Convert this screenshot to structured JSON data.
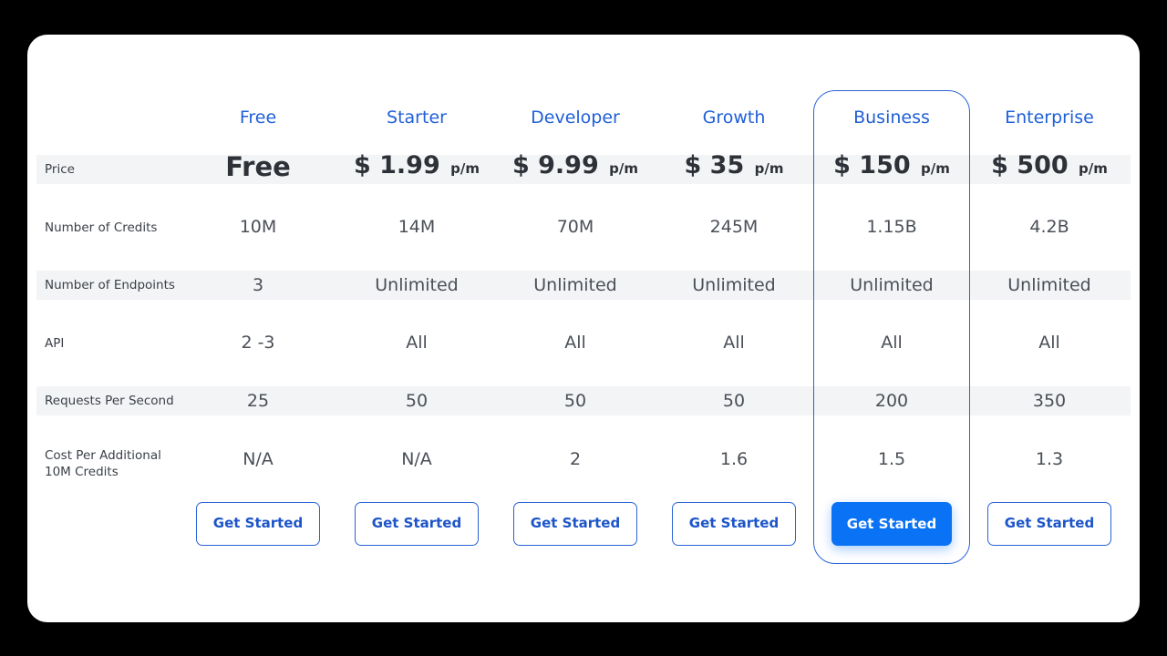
{
  "plans": [
    {
      "name": "Free",
      "price": "Free",
      "price_unit": "",
      "credits": "10M",
      "endpoints": "3",
      "api": "2 -3",
      "rps": "25",
      "cost_additional": "N/A",
      "cta": "Get Started"
    },
    {
      "name": "Starter",
      "price": "$ 1.99",
      "price_unit": "p/m",
      "credits": "14M",
      "endpoints": "Unlimited",
      "api": "All",
      "rps": "50",
      "cost_additional": "N/A",
      "cta": "Get Started"
    },
    {
      "name": "Developer",
      "price": "$ 9.99",
      "price_unit": "p/m",
      "credits": "70M",
      "endpoints": "Unlimited",
      "api": "All",
      "rps": "50",
      "cost_additional": "2",
      "cta": "Get Started"
    },
    {
      "name": "Growth",
      "price": "$ 35",
      "price_unit": "p/m",
      "credits": "245M",
      "endpoints": "Unlimited",
      "api": "All",
      "rps": "50",
      "cost_additional": "1.6",
      "cta": "Get Started"
    },
    {
      "name": "Business",
      "price": "$ 150",
      "price_unit": "p/m",
      "credits": "1.15B",
      "endpoints": "Unlimited",
      "api": "All",
      "rps": "200",
      "cost_additional": "1.5",
      "cta": "Get Started",
      "highlighted": true
    },
    {
      "name": "Enterprise",
      "price": "$ 500",
      "price_unit": "p/m",
      "credits": "4.2B",
      "endpoints": "Unlimited",
      "api": "All",
      "rps": "350",
      "cost_additional": "1.3",
      "cta": "Get Started"
    }
  ],
  "row_labels": {
    "price": "Price",
    "credits": "Number of Credits",
    "endpoints": "Number of Endpoints",
    "api": "API",
    "rps": "Requests Per Second",
    "cost_additional_line1": "Cost Per Additional",
    "cost_additional_line2": "10M Credits"
  },
  "colors": {
    "accent": "#1f5fd8",
    "primary_button": "#0a72f5",
    "band": "#f3f4f6",
    "background": "#000000"
  }
}
